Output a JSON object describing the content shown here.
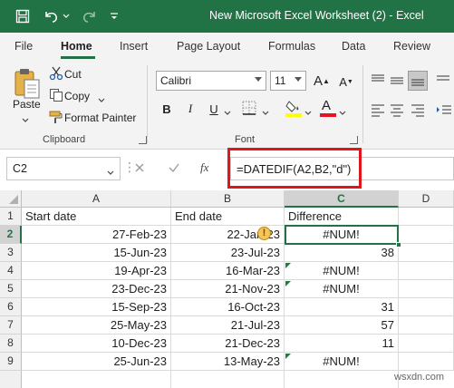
{
  "titlebar": {
    "title": "New Microsoft Excel Worksheet (2)  -  Excel",
    "icons": [
      "save-icon",
      "undo-icon",
      "undo-dropdown-icon",
      "redo-icon",
      "qat-customize-icon"
    ]
  },
  "tabs": [
    "File",
    "Home",
    "Insert",
    "Page Layout",
    "Formulas",
    "Data",
    "Review"
  ],
  "active_tab": "Home",
  "ribbon": {
    "clipboard": {
      "paste": "Paste",
      "cut": "Cut",
      "copy": "Copy",
      "format_painter": "Format Painter",
      "label": "Clipboard"
    },
    "font": {
      "name": "Calibri",
      "size": "11",
      "bold": "B",
      "italic": "I",
      "underline": "U",
      "font_color_letter": "A",
      "label": "Font"
    }
  },
  "formula_bar": {
    "name_box": "C2",
    "fx": "fx",
    "formula": "=DATEDIF(A2,B2,\"d\")"
  },
  "grid": {
    "columns": [
      "A",
      "B",
      "C",
      "D"
    ],
    "rows": [
      {
        "n": "1",
        "a": "Start date",
        "b": "End date",
        "c": "Difference"
      },
      {
        "n": "2",
        "a": "27-Feb-23",
        "b": "22-Jan-23",
        "c": "#NUM!"
      },
      {
        "n": "3",
        "a": "15-Jun-23",
        "b": "23-Jul-23",
        "c": "38"
      },
      {
        "n": "4",
        "a": "19-Apr-23",
        "b": "16-Mar-23",
        "c": "#NUM!"
      },
      {
        "n": "5",
        "a": "23-Dec-23",
        "b": "21-Nov-23",
        "c": "#NUM!"
      },
      {
        "n": "6",
        "a": "15-Sep-23",
        "b": "16-Oct-23",
        "c": "31"
      },
      {
        "n": "7",
        "a": "25-May-23",
        "b": "21-Jul-23",
        "c": "57"
      },
      {
        "n": "8",
        "a": "10-Dec-23",
        "b": "21-Dec-23",
        "c": "11"
      },
      {
        "n": "9",
        "a": "25-Jun-23",
        "b": "13-May-23",
        "c": "#NUM!"
      }
    ],
    "selected_cell": "C2",
    "warning_glyph": "!"
  },
  "watermark": "wsxdn.com",
  "colors": {
    "excel_green": "#217346",
    "highlight_box": "#e0161d",
    "error_triangle": "#1e7d3a",
    "highlighter_yellow": "#ffff00",
    "font_color_red": "#e81123"
  }
}
